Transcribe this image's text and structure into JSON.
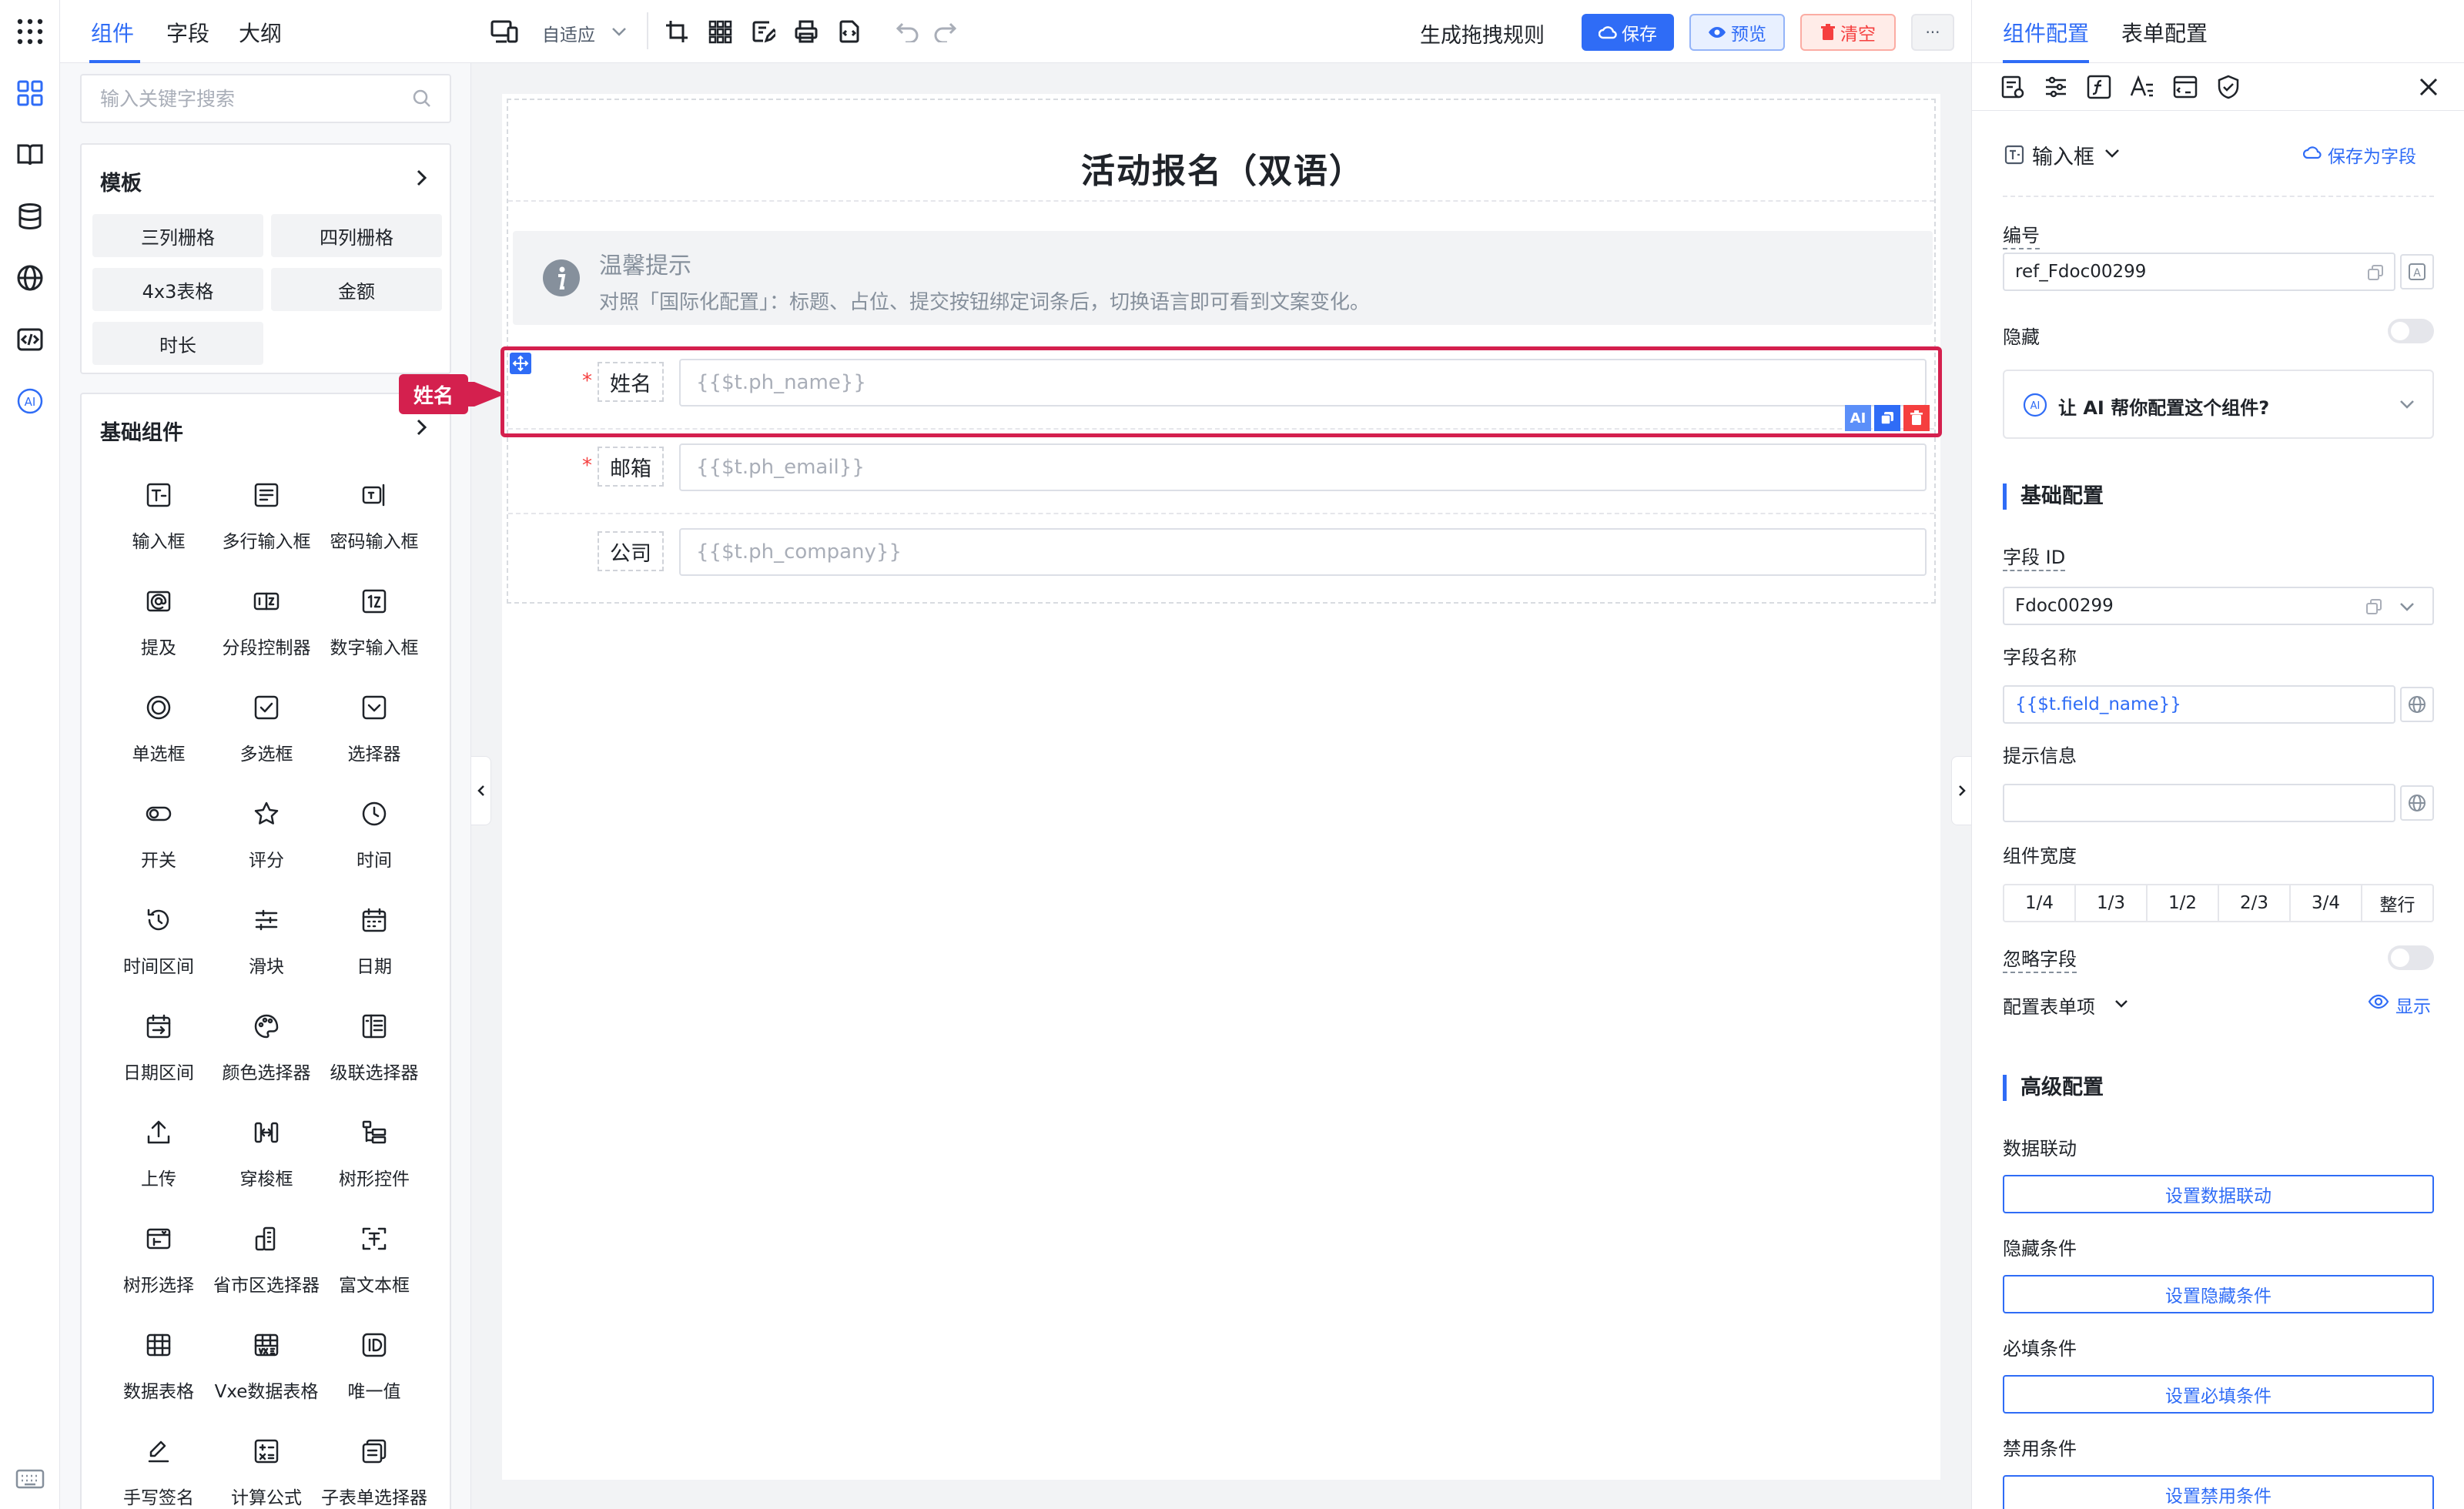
{
  "sidebar_tabs": [
    "组件",
    "字段",
    "大纲"
  ],
  "search": {
    "placeholder": "输入关键字搜索"
  },
  "templates": {
    "title": "模板",
    "items": [
      "三列栅格",
      "四列栅格",
      "4x3表格",
      "金额",
      "时长"
    ]
  },
  "basic": {
    "title": "基础组件",
    "items": [
      {
        "label": "输入框",
        "icon": "input-icon"
      },
      {
        "label": "多行输入框",
        "icon": "textarea-icon"
      },
      {
        "label": "密码输入框",
        "icon": "password-icon"
      },
      {
        "label": "提及",
        "icon": "mention-icon"
      },
      {
        "label": "分段控制器",
        "icon": "segmented-icon"
      },
      {
        "label": "数字输入框",
        "icon": "number-icon"
      },
      {
        "label": "单选框",
        "icon": "radio-icon"
      },
      {
        "label": "多选框",
        "icon": "checkbox-icon"
      },
      {
        "label": "选择器",
        "icon": "select-icon"
      },
      {
        "label": "开关",
        "icon": "switch-icon"
      },
      {
        "label": "评分",
        "icon": "star-icon"
      },
      {
        "label": "时间",
        "icon": "clock-icon"
      },
      {
        "label": "时间区间",
        "icon": "time-range-icon"
      },
      {
        "label": "滑块",
        "icon": "slider-icon"
      },
      {
        "label": "日期",
        "icon": "calendar-icon"
      },
      {
        "label": "日期区间",
        "icon": "date-range-icon"
      },
      {
        "label": "颜色选择器",
        "icon": "palette-icon"
      },
      {
        "label": "级联选择器",
        "icon": "cascader-icon"
      },
      {
        "label": "上传",
        "icon": "upload-icon"
      },
      {
        "label": "穿梭框",
        "icon": "transfer-icon"
      },
      {
        "label": "树形控件",
        "icon": "tree-icon"
      },
      {
        "label": "树形选择",
        "icon": "tree-select-icon"
      },
      {
        "label": "省市区选择器",
        "icon": "region-icon"
      },
      {
        "label": "富文本框",
        "icon": "richtext-icon"
      },
      {
        "label": "数据表格",
        "icon": "table-icon"
      },
      {
        "label": "Vxe数据表格",
        "icon": "vxe-table-icon"
      },
      {
        "label": "唯一值",
        "icon": "id-icon"
      },
      {
        "label": "手写签名",
        "icon": "signature-icon"
      },
      {
        "label": "计算公式",
        "icon": "formula-icon"
      },
      {
        "label": "子表单选择器",
        "icon": "subform-icon"
      }
    ]
  },
  "toolbar": {
    "adapt": "自适应",
    "rules": "生成拖拽规则",
    "save": "保存",
    "preview": "预览",
    "clear": "清空",
    "more": "···"
  },
  "form": {
    "title": "活动报名（双语）",
    "tip_title": "温馨提示",
    "tip_text": "对照「国际化配置」：标题、占位、提交按钮绑定词条后，切换语言即可看到文案变化。",
    "fields": [
      {
        "label": "姓名",
        "placeholder": "{{$t.ph_name}}",
        "required": true
      },
      {
        "label": "邮箱",
        "placeholder": "{{$t.ph_email}}",
        "required": true
      },
      {
        "label": "公司",
        "placeholder": "{{$t.ph_company}}",
        "required": false
      }
    ],
    "selected_tag": "姓名",
    "required_mark": "*",
    "ai_mark": "AI"
  },
  "right": {
    "tabs": [
      "组件配置",
      "表单配置"
    ],
    "component_type": "输入框",
    "save_as_field": "保存为字段",
    "ref_label": "编号",
    "ref_value": "ref_Fdoc00299",
    "hidden_label": "隐藏",
    "ai_prompt": "让 AI 帮你配置这个组件?",
    "basic_section": "基础配置",
    "field_id_label": "字段 ID",
    "field_id_value": "Fdoc00299",
    "field_name_label": "字段名称",
    "field_name_value": "{{$t.field_name}}",
    "hint_label": "提示信息",
    "hint_value": "",
    "width_label": "组件宽度",
    "width_options": [
      "1/4",
      "1/3",
      "1/2",
      "2/3",
      "3/4",
      "整行"
    ],
    "ignore_label": "忽略字段",
    "form_item_label": "配置表单项",
    "show_label": "显示",
    "advanced_section": "高级配置",
    "linkage_label": "数据联动",
    "linkage_btn": "设置数据联动",
    "hide_cond_label": "隐藏条件",
    "hide_cond_btn": "设置隐藏条件",
    "required_cond_label": "必填条件",
    "required_cond_btn": "设置必填条件",
    "disabled_cond_label": "禁用条件",
    "disabled_cond_btn": "设置禁用条件"
  },
  "colors": {
    "primary": "#2f6cf6",
    "danger": "#f53f3f",
    "selected": "#d4204e"
  }
}
